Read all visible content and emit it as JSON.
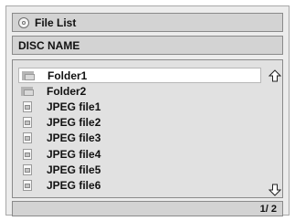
{
  "header": {
    "title": "File List",
    "icon": "disc-icon"
  },
  "disc": {
    "name": "DISC NAME"
  },
  "list": {
    "selected_index": 0,
    "items": [
      {
        "label": "Folder1",
        "type": "folder"
      },
      {
        "label": "Folder2",
        "type": "folder"
      },
      {
        "label": "JPEG file1",
        "type": "jpeg-file"
      },
      {
        "label": "JPEG file2",
        "type": "jpeg-file"
      },
      {
        "label": "JPEG file3",
        "type": "jpeg-file"
      },
      {
        "label": "JPEG file4",
        "type": "jpeg-file"
      },
      {
        "label": "JPEG file5",
        "type": "jpeg-file"
      },
      {
        "label": "JPEG file6",
        "type": "jpeg-file"
      }
    ]
  },
  "footer": {
    "page_indicator": "1/ 2"
  },
  "colors": {
    "panel": "#ececec",
    "bar": "#d3d3d3",
    "selected": "#ffffff"
  }
}
